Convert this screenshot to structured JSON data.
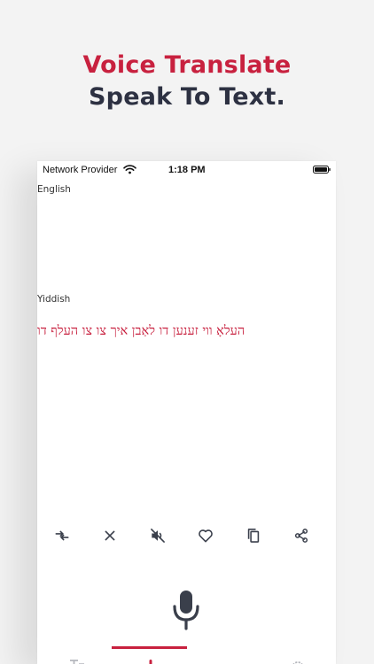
{
  "promo": {
    "headline": "Voice Translate",
    "subheadline": "Speak To Text."
  },
  "status_bar": {
    "carrier": "Network Provider",
    "time": "1:18 PM"
  },
  "translator": {
    "source_language": "English",
    "source_text": "",
    "target_language": "Yiddish",
    "target_text": "העלאָ ווי זענען דו לאַבן איך צו צו העלף דו"
  },
  "toolbar": {
    "icons": [
      "swap-icon",
      "clear-icon",
      "mute-icon",
      "favorite-icon",
      "copy-icon",
      "share-icon"
    ]
  },
  "mic": {
    "icon": "microphone-icon"
  },
  "tabbar": {
    "active_index": 1,
    "icons": [
      "text-tab-icon",
      "voice-tab-icon",
      "more-tab-icon",
      "settings-tab-icon"
    ]
  },
  "colors": {
    "accent": "#c8213f",
    "dark_text": "#2d3142",
    "icon_gray": "#3a3f4b",
    "background": "#f3f3f3"
  }
}
